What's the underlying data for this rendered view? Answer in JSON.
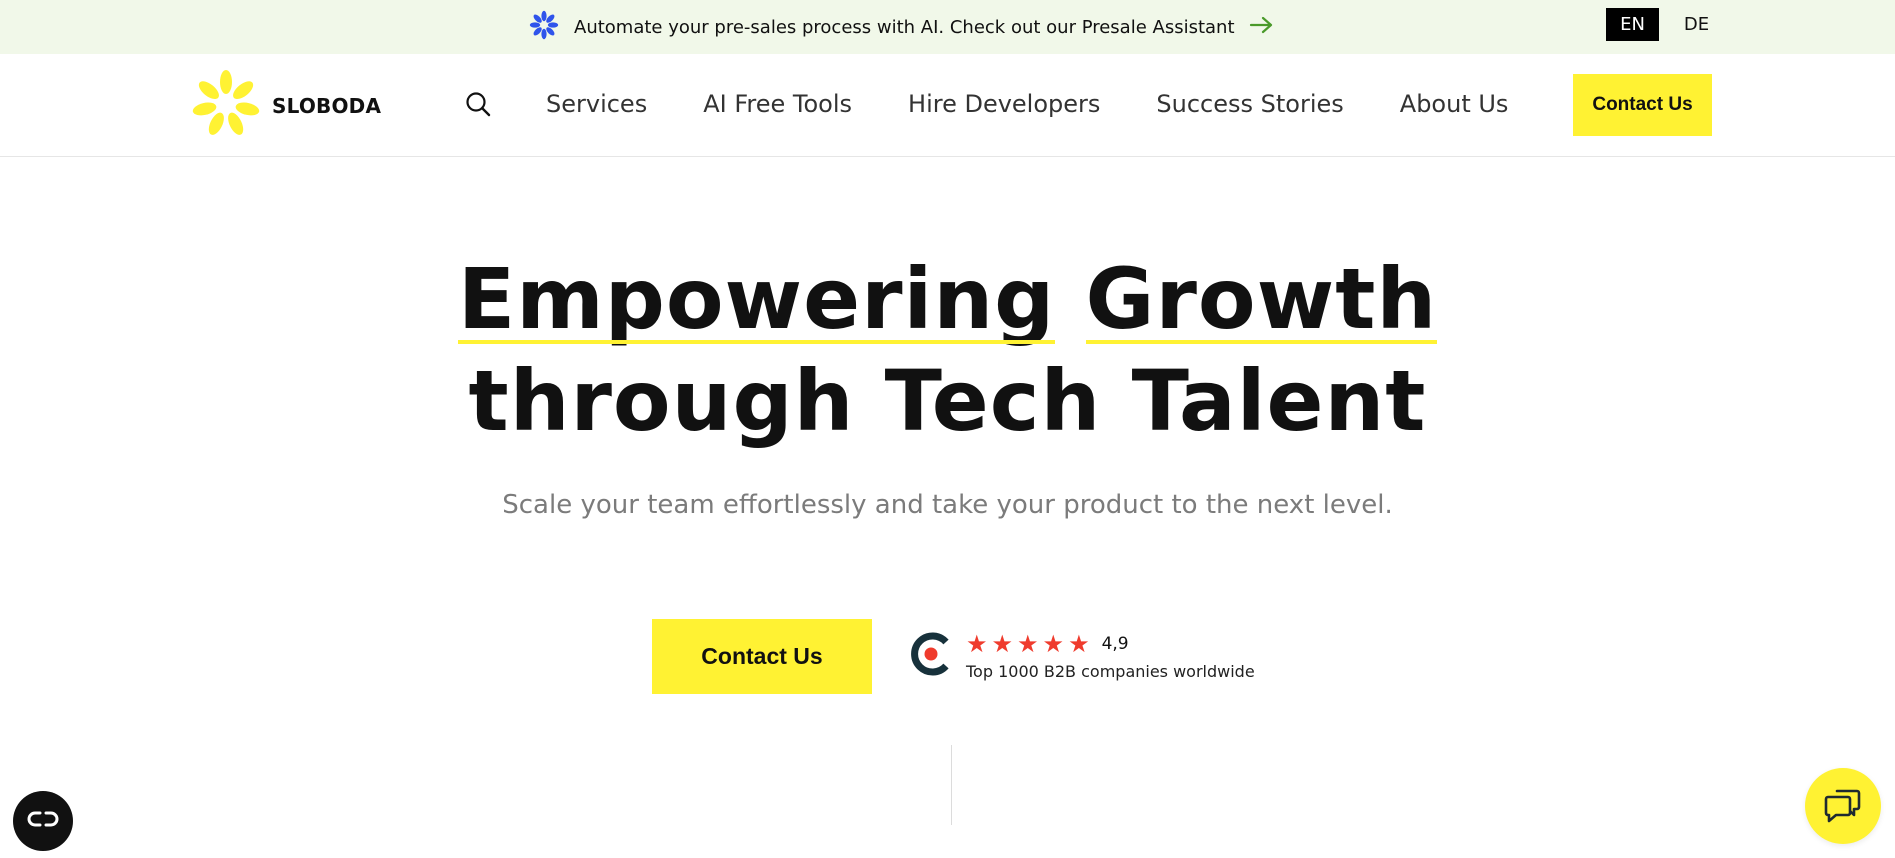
{
  "announcement": {
    "text": "Automate your pre-sales process with AI. Check out our Presale Assistant",
    "icon": "blue-flower-icon",
    "arrow_icon": "arrow-right-icon",
    "languages": [
      "EN",
      "DE"
    ],
    "active_language": "EN"
  },
  "header": {
    "logo_text": "SLOBODA",
    "nav": [
      "Services",
      "AI Free Tools",
      "Hire Developers",
      "Success Stories",
      "About Us"
    ],
    "cta_label": "Contact Us"
  },
  "hero": {
    "title_line1_word1": "Empowering",
    "title_line1_word2": "Growth",
    "title_line2": "through Tech Talent",
    "subtitle": "Scale your team effortlessly and take your product to the next level.",
    "cta_label": "Contact Us",
    "rating": {
      "score": "4,9",
      "stars": 5,
      "caption": "Top 1000 B2B companies worldwide"
    }
  },
  "colors": {
    "accent_yellow": "#fff233",
    "announce_bg": "#f1f8e9",
    "star_red": "#ef3b2d",
    "flower_blue": "#2f54eb",
    "arrow_green": "#4a9a2a"
  }
}
